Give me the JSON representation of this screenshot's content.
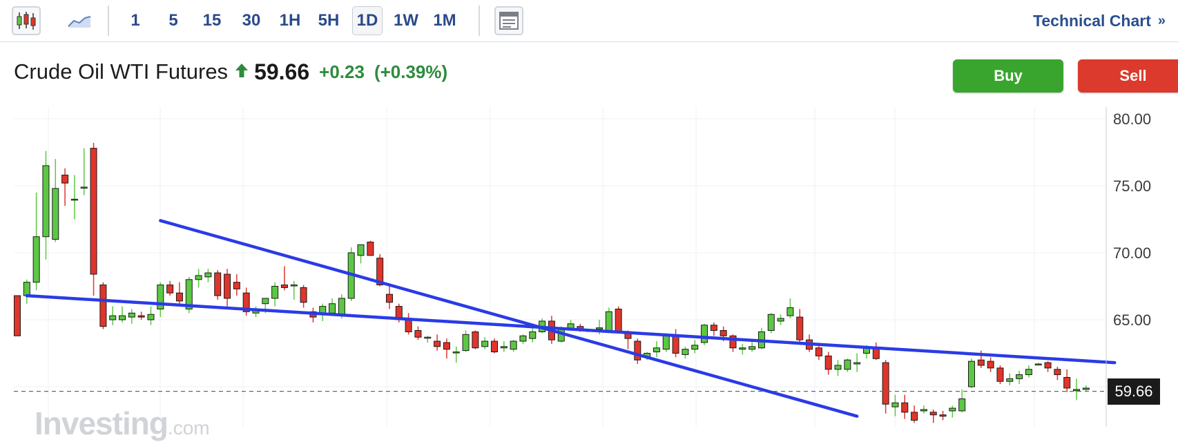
{
  "toolbar": {
    "candles_icon": "candlestick-chart-icon",
    "area_icon": "area-chart-icon",
    "timeframes": [
      "1",
      "5",
      "15",
      "30",
      "1H",
      "5H",
      "1D",
      "1W",
      "1M"
    ],
    "active_timeframe": "1D",
    "settings_icon": "chart-settings-icon",
    "technical_chart_label": "Technical Chart",
    "technical_chart_chevron": "»"
  },
  "instrument": {
    "name": "Crude Oil WTI Futures",
    "direction_icon": "up-arrow-icon",
    "price": "59.66",
    "change": "+0.23",
    "change_percent": "(+0.39%)"
  },
  "actions": {
    "buy_label": "Buy",
    "sell_label": "Sell"
  },
  "watermark": {
    "brand": "Investing",
    "suffix": ".com"
  },
  "colors": {
    "up": "#5cc743",
    "down": "#e0352b",
    "trendline": "#2a3be6",
    "accent": "#2a4f8f",
    "buy": "#3aa52e",
    "sell": "#db3a2c"
  },
  "chart_data": {
    "type": "candlestick",
    "y_axis_labels": [
      "80.00",
      "75.00",
      "70.00",
      "65.00"
    ],
    "ylim": [
      58.5,
      80.8
    ],
    "current_price_label": "59.66",
    "current_price": 59.66,
    "grid": true,
    "trendlines": [
      {
        "from": [
          1,
          66.8
        ],
        "to": [
          115,
          61.8
        ]
      },
      {
        "from": [
          15,
          72.4
        ],
        "to": [
          88,
          57.8
        ]
      }
    ],
    "candles": [
      [
        66.8,
        66.8,
        63.8,
        63.8
      ],
      [
        66.8,
        68.0,
        66.2,
        67.8
      ],
      [
        67.8,
        74.5,
        67.2,
        71.2
      ],
      [
        71.2,
        77.6,
        69.5,
        76.5
      ],
      [
        71.0,
        77.0,
        70.8,
        74.8
      ],
      [
        75.8,
        76.3,
        73.5,
        75.2
      ],
      [
        74.0,
        75.8,
        72.5,
        74.0
      ],
      [
        74.9,
        77.8,
        74.3,
        74.9
      ],
      [
        77.8,
        78.2,
        66.8,
        68.4
      ],
      [
        67.6,
        67.8,
        64.3,
        64.5
      ],
      [
        65.0,
        66.0,
        64.6,
        65.3
      ],
      [
        65.0,
        66.0,
        64.8,
        65.3
      ],
      [
        65.2,
        65.8,
        64.7,
        65.5
      ],
      [
        65.3,
        65.6,
        65.0,
        65.2
      ],
      [
        65.0,
        66.0,
        64.6,
        65.4
      ],
      [
        65.8,
        67.8,
        65.2,
        67.6
      ],
      [
        67.6,
        67.9,
        66.8,
        67.0
      ],
      [
        67.0,
        67.8,
        66.2,
        66.4
      ],
      [
        65.8,
        68.2,
        65.5,
        68.0
      ],
      [
        68.0,
        68.8,
        67.4,
        68.3
      ],
      [
        68.2,
        68.8,
        67.8,
        68.5
      ],
      [
        68.5,
        68.7,
        66.5,
        66.8
      ],
      [
        68.4,
        68.8,
        66.0,
        66.6
      ],
      [
        67.8,
        68.4,
        66.8,
        67.3
      ],
      [
        67.0,
        67.4,
        65.3,
        65.6
      ],
      [
        65.5,
        66.0,
        65.2,
        65.8
      ],
      [
        66.2,
        66.6,
        65.5,
        66.6
      ],
      [
        66.6,
        67.8,
        66.0,
        67.5
      ],
      [
        67.6,
        69.0,
        67.2,
        67.4
      ],
      [
        67.6,
        67.9,
        66.5,
        67.6
      ],
      [
        67.4,
        67.6,
        65.9,
        66.3
      ],
      [
        65.6,
        65.9,
        64.8,
        65.2
      ],
      [
        65.4,
        66.2,
        64.9,
        66.0
      ],
      [
        65.5,
        66.6,
        65.3,
        66.2
      ],
      [
        65.3,
        66.9,
        65.1,
        66.6
      ],
      [
        66.6,
        70.4,
        66.4,
        70.0
      ],
      [
        69.8,
        70.5,
        69.2,
        70.6
      ],
      [
        70.8,
        70.9,
        69.8,
        69.8
      ],
      [
        69.6,
        69.9,
        67.5,
        67.6
      ],
      [
        66.9,
        67.6,
        65.8,
        66.3
      ],
      [
        66.0,
        66.2,
        64.8,
        65.0
      ],
      [
        65.0,
        65.5,
        63.9,
        64.1
      ],
      [
        64.2,
        64.5,
        63.5,
        63.7
      ],
      [
        63.7,
        63.8,
        63.3,
        63.7
      ],
      [
        63.4,
        63.9,
        62.7,
        63.0
      ],
      [
        63.3,
        63.6,
        62.1,
        62.8
      ],
      [
        62.6,
        63.0,
        61.8,
        62.6
      ],
      [
        62.7,
        64.2,
        62.6,
        63.9
      ],
      [
        64.1,
        64.2,
        62.8,
        62.9
      ],
      [
        63.0,
        63.7,
        62.8,
        63.4
      ],
      [
        63.4,
        63.6,
        62.5,
        62.6
      ],
      [
        62.9,
        63.4,
        62.6,
        63.0
      ],
      [
        62.8,
        63.5,
        62.6,
        63.4
      ],
      [
        63.4,
        63.9,
        63.2,
        63.8
      ],
      [
        63.6,
        64.4,
        63.3,
        64.1
      ],
      [
        64.1,
        65.1,
        64.0,
        64.9
      ],
      [
        64.9,
        65.3,
        63.2,
        63.5
      ],
      [
        63.4,
        64.5,
        63.3,
        64.4
      ],
      [
        64.3,
        65.0,
        64.2,
        64.7
      ],
      [
        64.5,
        64.7,
        64.1,
        64.3
      ],
      [
        64.2,
        64.3,
        64.1,
        64.2
      ],
      [
        64.3,
        65.0,
        63.9,
        64.4
      ],
      [
        64.1,
        65.9,
        64.0,
        65.6
      ],
      [
        65.8,
        66.0,
        64.0,
        64.1
      ],
      [
        64.1,
        64.2,
        62.8,
        63.6
      ],
      [
        63.4,
        63.6,
        61.7,
        62.0
      ],
      [
        62.2,
        62.6,
        62.0,
        62.5
      ],
      [
        62.6,
        63.4,
        62.2,
        62.9
      ],
      [
        62.8,
        64.0,
        62.6,
        63.8
      ],
      [
        63.8,
        64.3,
        62.2,
        62.5
      ],
      [
        62.4,
        63.0,
        62.1,
        62.8
      ],
      [
        62.8,
        63.5,
        62.5,
        63.1
      ],
      [
        63.3,
        64.7,
        63.1,
        64.6
      ],
      [
        64.6,
        64.8,
        63.8,
        64.2
      ],
      [
        64.2,
        64.5,
        63.4,
        63.8
      ],
      [
        63.8,
        63.9,
        62.6,
        62.9
      ],
      [
        62.8,
        63.2,
        62.4,
        62.9
      ],
      [
        62.8,
        63.5,
        62.6,
        63.0
      ],
      [
        62.9,
        64.4,
        62.8,
        64.1
      ],
      [
        64.2,
        65.5,
        64.0,
        65.4
      ],
      [
        64.9,
        65.4,
        64.6,
        65.1
      ],
      [
        65.3,
        66.6,
        65.1,
        65.9
      ],
      [
        65.2,
        65.8,
        63.3,
        63.5
      ],
      [
        63.5,
        63.9,
        62.6,
        62.8
      ],
      [
        62.9,
        63.1,
        62.0,
        62.3
      ],
      [
        62.3,
        62.6,
        60.9,
        61.3
      ],
      [
        61.3,
        62.0,
        60.8,
        61.6
      ],
      [
        61.3,
        62.1,
        61.1,
        62.0
      ],
      [
        61.7,
        62.5,
        61.1,
        61.8
      ],
      [
        62.5,
        63.1,
        62.1,
        62.9
      ],
      [
        62.9,
        63.3,
        62.0,
        62.1
      ],
      [
        61.8,
        62.0,
        58.0,
        58.7
      ],
      [
        58.5,
        59.4,
        57.8,
        58.8
      ],
      [
        58.8,
        59.4,
        57.6,
        58.1
      ],
      [
        58.1,
        58.6,
        57.3,
        57.5
      ],
      [
        58.2,
        58.6,
        58.0,
        58.3
      ],
      [
        58.1,
        58.3,
        57.3,
        57.9
      ],
      [
        57.9,
        58.2,
        57.5,
        57.8
      ],
      [
        58.2,
        58.6,
        57.7,
        58.4
      ],
      [
        58.2,
        59.8,
        58.1,
        59.1
      ],
      [
        60.0,
        62.1,
        59.9,
        61.9
      ],
      [
        62.0,
        62.7,
        61.4,
        61.6
      ],
      [
        61.9,
        62.2,
        61.1,
        61.4
      ],
      [
        61.4,
        61.6,
        60.2,
        60.4
      ],
      [
        60.4,
        61.0,
        60.1,
        60.6
      ],
      [
        60.6,
        61.2,
        60.2,
        60.9
      ],
      [
        60.9,
        61.6,
        60.7,
        61.3
      ],
      [
        61.7,
        61.8,
        61.6,
        61.7
      ],
      [
        61.8,
        61.9,
        61.1,
        61.4
      ],
      [
        61.3,
        61.5,
        60.5,
        60.9
      ],
      [
        60.7,
        61.3,
        59.6,
        59.9
      ],
      [
        59.7,
        60.6,
        59.0,
        59.8
      ],
      [
        59.8,
        60.1,
        59.7,
        59.9
      ]
    ]
  }
}
